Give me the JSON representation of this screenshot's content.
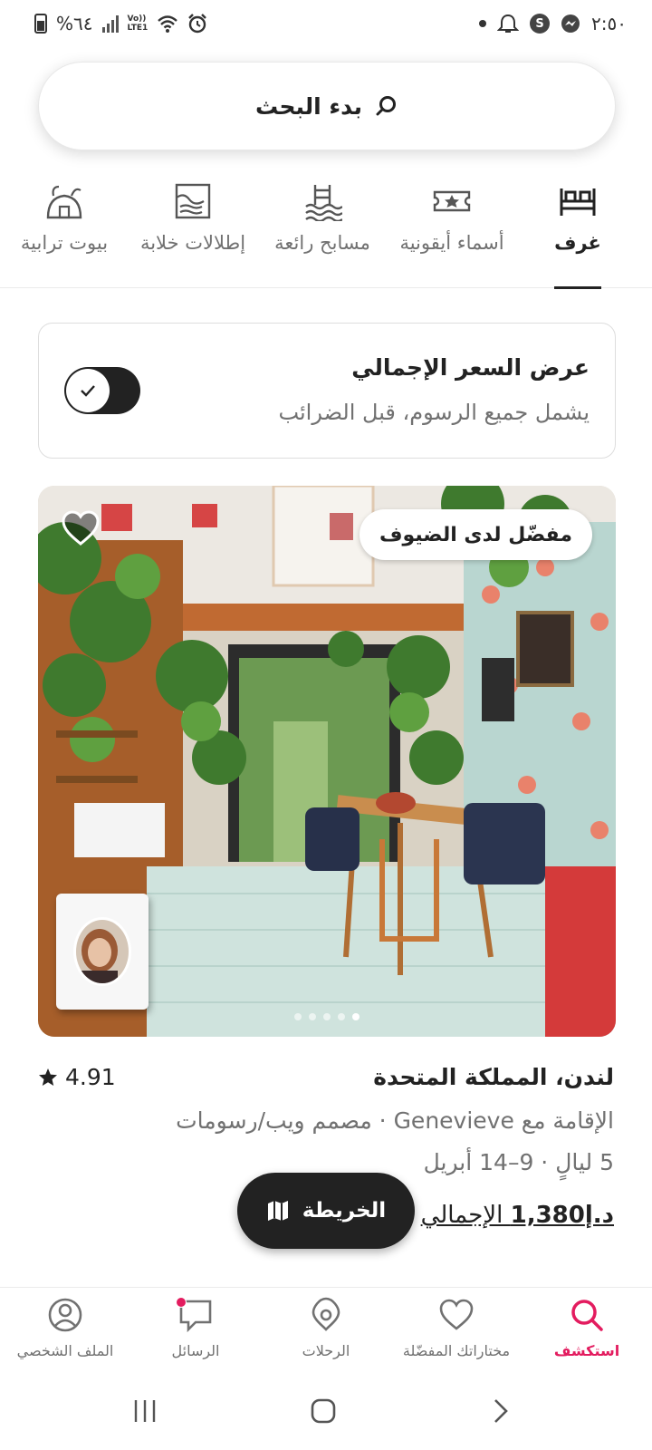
{
  "status_bar": {
    "time": "٢:٥٠",
    "battery_percent": "%٦٤",
    "network": "LTE1",
    "network_prefix": "Vo))",
    "app_notification": "S"
  },
  "search": {
    "label": "بدء البحث"
  },
  "categories": [
    {
      "label": "غرف",
      "icon": "bed-icon",
      "active": true
    },
    {
      "label": "أسماء أيقونية",
      "icon": "ticket-star-icon",
      "active": false
    },
    {
      "label": "مسابح رائعة",
      "icon": "pool-icon",
      "active": false
    },
    {
      "label": "إطلالات خلابة",
      "icon": "scenic-view-icon",
      "active": false
    },
    {
      "label": "بيوت ترابية",
      "icon": "earth-home-icon",
      "active": false
    }
  ],
  "total_price_toggle": {
    "title": "عرض السعر الإجمالي",
    "subtitle": "يشمل جميع الرسوم، قبل الضرائب",
    "enabled": false
  },
  "listing": {
    "badge": "مفضّل لدى الضيوف",
    "title": "لندن، المملكة المتحدة",
    "rating": "4.91",
    "host_line": "الإقامة مع Genevieve · مصمم ويب/رسومات",
    "dates": "5 ليالٍ · 9–14 أبريل",
    "price_amount": "د.إ1,380",
    "price_suffix": " الإجمالي",
    "photo_count": 5,
    "photo_index": 0
  },
  "map_button": {
    "label": "الخريطة"
  },
  "bottom_nav": [
    {
      "label": "استكشف",
      "icon": "search-icon",
      "active": true
    },
    {
      "label": "مختاراتك المفضّلة",
      "icon": "heart-icon",
      "active": false
    },
    {
      "label": "الرحلات",
      "icon": "airbnb-icon",
      "active": false
    },
    {
      "label": "الرسائل",
      "icon": "message-icon",
      "active": false,
      "notification": true
    },
    {
      "label": "الملف الشخصي",
      "icon": "profile-icon",
      "active": false
    }
  ],
  "colors": {
    "accent": "#e31c5f",
    "text": "#222222",
    "muted": "#717171"
  }
}
